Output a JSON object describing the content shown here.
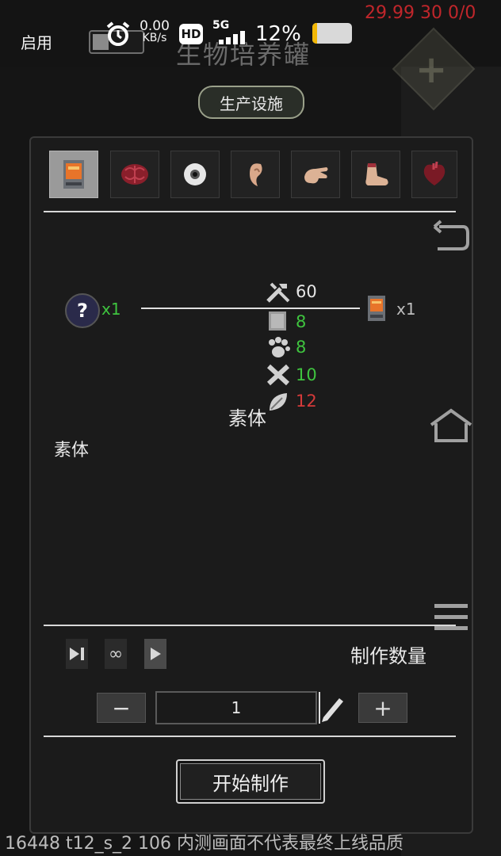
{
  "status_bar": {
    "toggle_label": "启用",
    "speed_value": "0.00",
    "speed_unit": "KB/s",
    "hd_badge": "HD",
    "network": "5G",
    "battery_percent": "12%",
    "battery_level": 0.12,
    "fps_debug": "29.99 30 0/0"
  },
  "header": {
    "title": "生物培养罐",
    "category_tag": "生产设施"
  },
  "tabs": [
    {
      "name": "terminal-icon",
      "active": true
    },
    {
      "name": "brain-icon",
      "active": false
    },
    {
      "name": "eyeball-icon",
      "active": false
    },
    {
      "name": "ear-icon",
      "active": false
    },
    {
      "name": "hand-icon",
      "active": false
    },
    {
      "name": "foot-icon",
      "active": false
    },
    {
      "name": "heart-icon",
      "active": false
    }
  ],
  "recipe": {
    "input_icon": "question-icon",
    "input_qty": "x1",
    "output_icon": "terminal-icon",
    "output_qty": "x1",
    "requirements": [
      {
        "icon": "wrench-hammer-icon",
        "value": "60",
        "color": "#e6e6e6"
      },
      {
        "icon": "paper-icon",
        "value": "8",
        "color": "#3fc43f"
      },
      {
        "icon": "paw-icon",
        "value": "8",
        "color": "#3fc43f"
      },
      {
        "icon": "tools-cross-icon",
        "value": "10",
        "color": "#3fc43f"
      },
      {
        "icon": "leaf-icon",
        "value": "12",
        "color": "#d53a3a"
      }
    ],
    "material_center": "素体",
    "material_left": "素体"
  },
  "controls": {
    "quantity_label": "制作数量",
    "quantity_value": "1",
    "minus_label": "−",
    "plus_label": "+",
    "infinite_label": "∞",
    "start_button": "开始制作"
  },
  "footer": {
    "build_info": "16448 t12_s_2 106  内测画面不代表最终上线品质"
  }
}
